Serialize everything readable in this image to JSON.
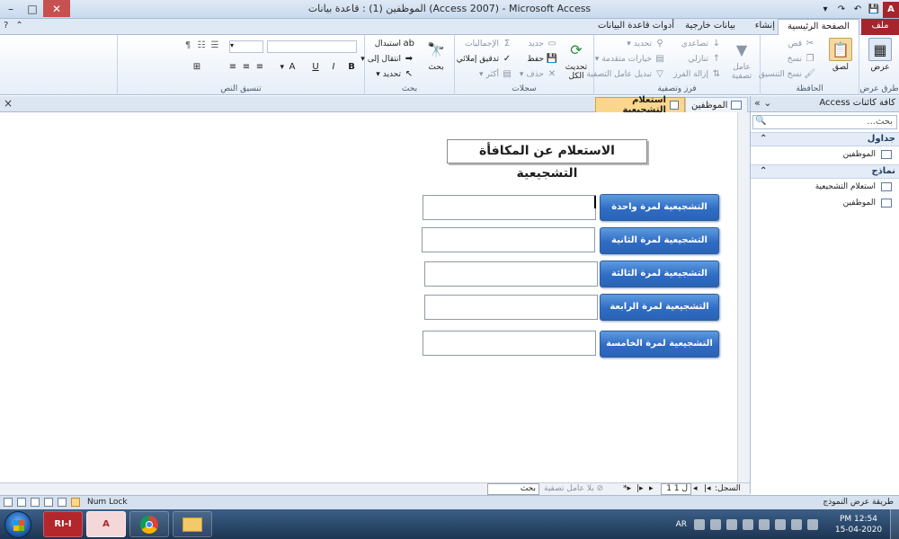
{
  "window": {
    "title": "الموظفين (1) : قاعدة بيانات (Access 2007) - Microsoft Access",
    "controls": [
      "close-icon",
      "maximize-icon",
      "minimize-icon"
    ]
  },
  "ribbon_tabs": {
    "file": "ملف",
    "home": "الصفحة الرئيسية",
    "create": "إنشاء",
    "external": "بيانات خارجية",
    "dbtools": "أدوات قاعدة البيانات"
  },
  "ribbon": {
    "views": {
      "label": "عرض",
      "group": "طرق عرض"
    },
    "clipboard": {
      "paste": "لصق",
      "cut": "قص",
      "copy": "نسخ",
      "format_painter": "نسخ التنسيق",
      "group": "الحافظة"
    },
    "sort_filter": {
      "filter": "عامل تصفية",
      "ascending": "تصاعدي",
      "descending": "تنازلي",
      "remove_sort": "إزالة الفرز",
      "selection": "تحديد",
      "advanced": "خيارات متقدمة",
      "toggle_filter": "تبديل عامل التصفية",
      "group": "فرز وتصفية"
    },
    "records": {
      "refresh": "تحديث الكل",
      "new": "جديد",
      "save": "حفظ",
      "delete": "حذف",
      "totals": "الإجماليات",
      "spelling": "تدقيق إملائي",
      "more": "أكثر",
      "group": "سجلات"
    },
    "find": {
      "find": "بحث",
      "replace": "استبدال",
      "goto": "انتقال إلى",
      "select": "تحديد",
      "group": "بحث"
    },
    "text_format": {
      "group": "تنسيق النص",
      "bold": "B",
      "italic": "I",
      "underline": "U",
      "font_color": "A"
    }
  },
  "doc_tabs": {
    "close": "×",
    "active": "استعلام التشجيعية",
    "other": "الموظفين"
  },
  "form": {
    "title": "الاستعلام عن المكافأة التشجيعية",
    "buttons": [
      "التشجيعية لمرة واحدة",
      "التشجيعية لمرة الثانية",
      "التشجيعية لمرة الثالثة",
      "التشجيعية لمرة الرابعة",
      "التشجيعية لمرة الخامسة"
    ],
    "fields": [
      "",
      "",
      "",
      "",
      ""
    ]
  },
  "nav_pane": {
    "header": "كافة كائنات Access",
    "search_placeholder": "بحث...",
    "groups": [
      {
        "label": "جداول",
        "items": [
          "الموظفين"
        ]
      },
      {
        "label": "نماذج",
        "items": [
          "استعلام التشجيعية",
          "الموظفين"
        ]
      }
    ]
  },
  "record_nav": {
    "label": "السجل:",
    "position": "1 ل 1",
    "no_filter": "بلا عامل تصفية",
    "search": "بحث"
  },
  "status_bar": {
    "view": "طريقة عرض النموذج",
    "numlock": "Num Lock"
  },
  "taskbar": {
    "apps": [
      "RI-I",
      "A",
      "chrome-icon",
      "explorer-icon"
    ],
    "lang": "AR",
    "time": "PM 12:54",
    "date": "15-04-2020"
  },
  "colors": {
    "button_blue": "#2f6cc4",
    "file_tab": "#a4262c",
    "active_tab": "#fbd78e"
  }
}
